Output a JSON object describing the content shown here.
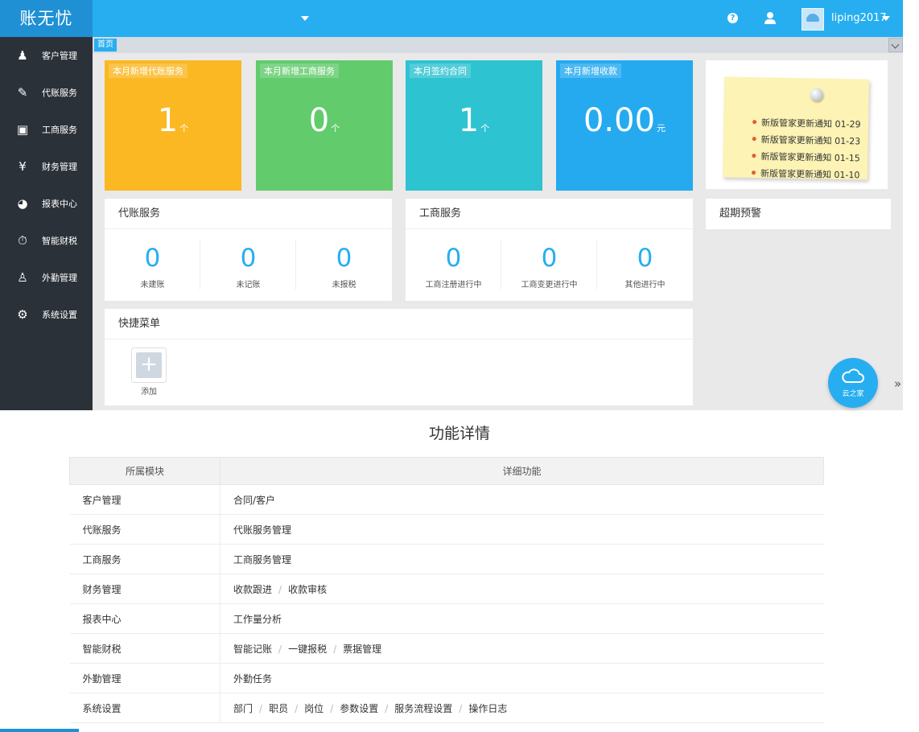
{
  "app": {
    "logo": "账无忧",
    "username": "liping2017"
  },
  "sidebar": {
    "items": [
      {
        "label": "客户管理",
        "icon": "users-icon"
      },
      {
        "label": "代账服务",
        "icon": "pen-icon"
      },
      {
        "label": "工商服务",
        "icon": "briefcase-icon"
      },
      {
        "label": "财务管理",
        "icon": "yen-icon"
      },
      {
        "label": "报表中心",
        "icon": "pie-chart-icon"
      },
      {
        "label": "智能财税",
        "icon": "stopwatch-icon"
      },
      {
        "label": "外勤管理",
        "icon": "person-pin-icon"
      },
      {
        "label": "系统设置",
        "icon": "gear-icon"
      }
    ]
  },
  "tabs": {
    "home": "首页"
  },
  "stats": [
    {
      "title": "本月新增代账服务",
      "value": "1",
      "unit": "个",
      "color": "#fbb823"
    },
    {
      "title": "本月新增工商服务",
      "value": "0",
      "unit": "个",
      "color": "#62cb6c"
    },
    {
      "title": "本月签约合同",
      "value": "1",
      "unit": "个",
      "color": "#2ec3d1"
    },
    {
      "title": "本月新增收款",
      "value": "0.00",
      "unit": "元",
      "color": "#25aaf0"
    }
  ],
  "notices": [
    "新版管家更新通知 01-29",
    "新版管家更新通知 01-23",
    "新版管家更新通知 01-15",
    "新版管家更新通知 01-10"
  ],
  "bookkeeping": {
    "title": "代账服务",
    "counters": [
      {
        "value": "0",
        "label": "未建账"
      },
      {
        "value": "0",
        "label": "未记账"
      },
      {
        "value": "0",
        "label": "未报税"
      }
    ]
  },
  "business": {
    "title": "工商服务",
    "counters": [
      {
        "value": "0",
        "label": "工商注册进行中"
      },
      {
        "value": "0",
        "label": "工商变更进行中"
      },
      {
        "value": "0",
        "label": "其他进行中"
      }
    ]
  },
  "overdue": {
    "title": "超期预警"
  },
  "quick_menu": {
    "title": "快捷菜单",
    "add_label": "添加"
  },
  "cloud": {
    "label": "云之家"
  },
  "details": {
    "title": "功能详情",
    "headers": [
      "所属模块",
      "详细功能"
    ],
    "rows": [
      {
        "module": "客户管理",
        "features": [
          "合同/客户"
        ]
      },
      {
        "module": "代账服务",
        "features": [
          "代账服务管理"
        ]
      },
      {
        "module": "工商服务",
        "features": [
          "工商服务管理"
        ]
      },
      {
        "module": "财务管理",
        "features": [
          "收款跟进",
          "收款审核"
        ]
      },
      {
        "module": "报表中心",
        "features": [
          "工作量分析"
        ]
      },
      {
        "module": "智能财税",
        "features": [
          "智能记账",
          "一键报税",
          "票据管理"
        ]
      },
      {
        "module": "外勤管理",
        "features": [
          "外勤任务"
        ]
      },
      {
        "module": "系统设置",
        "features": [
          "部门",
          "职员",
          "岗位",
          "参数设置",
          "服务流程设置",
          "操作日志"
        ]
      }
    ]
  }
}
